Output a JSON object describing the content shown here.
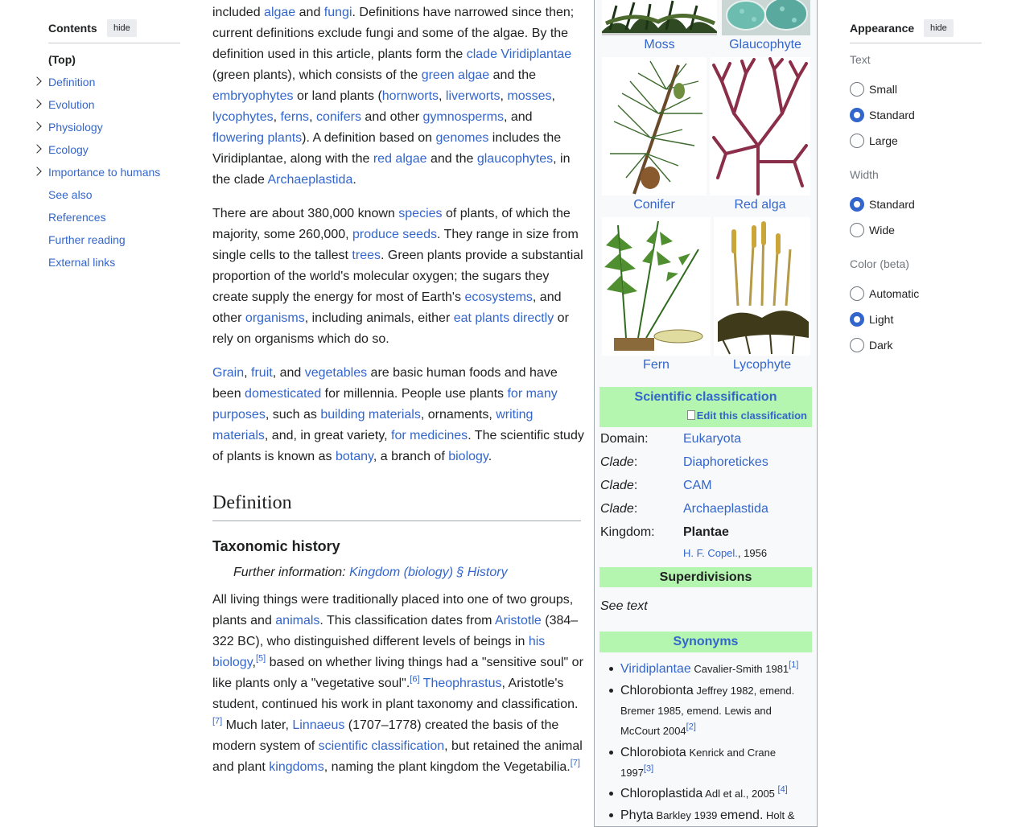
{
  "toc": {
    "title": "Contents",
    "hide_label": "hide",
    "items": [
      {
        "label": "(Top)",
        "expandable": false
      },
      {
        "label": "Definition",
        "expandable": true
      },
      {
        "label": "Evolution",
        "expandable": true
      },
      {
        "label": "Physiology",
        "expandable": true
      },
      {
        "label": "Ecology",
        "expandable": true
      },
      {
        "label": "Importance to humans",
        "expandable": true
      },
      {
        "label": "See also",
        "expandable": false
      },
      {
        "label": "References",
        "expandable": false
      },
      {
        "label": "Further reading",
        "expandable": false
      },
      {
        "label": "External links",
        "expandable": false
      }
    ]
  },
  "article": {
    "p1": [
      {
        "t": "included "
      },
      {
        "l": "algae"
      },
      {
        "t": " and "
      },
      {
        "l": "fungi"
      },
      {
        "t": ". Definitions have narrowed since then; current definitions exclude fungi and some of the algae. By the definition used in this article, plants form the "
      },
      {
        "l": "clade"
      },
      {
        "t": " "
      },
      {
        "l": "Viridiplantae"
      },
      {
        "t": " (green plants), which consists of the "
      },
      {
        "l": "green algae"
      },
      {
        "t": " and the "
      },
      {
        "l": "embryophytes"
      },
      {
        "t": " or land plants ("
      },
      {
        "l": "hornworts"
      },
      {
        "t": ", "
      },
      {
        "l": "liverworts"
      },
      {
        "t": ", "
      },
      {
        "l": "mosses"
      },
      {
        "t": ", "
      },
      {
        "l": "lycophytes"
      },
      {
        "t": ", "
      },
      {
        "l": "ferns"
      },
      {
        "t": ", "
      },
      {
        "l": "conifers"
      },
      {
        "t": " and other "
      },
      {
        "l": "gymnosperms"
      },
      {
        "t": ", and "
      },
      {
        "l": "flowering plants"
      },
      {
        "t": "). A definition based on "
      },
      {
        "l": "genomes"
      },
      {
        "t": " includes the Viridiplantae, along with the "
      },
      {
        "l": "red algae"
      },
      {
        "t": " and the "
      },
      {
        "l": "glaucophytes"
      },
      {
        "t": ", in the clade "
      },
      {
        "l": "Archaeplastida"
      },
      {
        "t": "."
      }
    ],
    "p2": [
      {
        "t": "There are about 380,000 known "
      },
      {
        "l": "species"
      },
      {
        "t": " of plants, of which the majority, some 260,000, "
      },
      {
        "l": "produce seeds"
      },
      {
        "t": ". They range in size from single cells to the tallest "
      },
      {
        "l": "trees"
      },
      {
        "t": ". Green plants provide a substantial proportion of the world's molecular oxygen; the sugars they create supply the energy for most of Earth's "
      },
      {
        "l": "ecosystems"
      },
      {
        "t": ", and other "
      },
      {
        "l": "organisms"
      },
      {
        "t": ", including animals, either "
      },
      {
        "l": "eat plants directly"
      },
      {
        "t": " or rely on organisms which do so."
      }
    ],
    "p3": [
      {
        "l": "Grain"
      },
      {
        "t": ", "
      },
      {
        "l": "fruit"
      },
      {
        "t": ", and "
      },
      {
        "l": "vegetables"
      },
      {
        "t": " are basic human foods and have been "
      },
      {
        "l": "domesticated"
      },
      {
        "t": " for millennia. People use plants "
      },
      {
        "l": "for many purposes"
      },
      {
        "t": ", such as "
      },
      {
        "l": "building materials"
      },
      {
        "t": ", ornaments, "
      },
      {
        "l": "writing materials"
      },
      {
        "t": ", and, in great variety, "
      },
      {
        "l": "for medicines"
      },
      {
        "t": ". The scientific study of plants is known as "
      },
      {
        "l": "botany"
      },
      {
        "t": ", a branch of "
      },
      {
        "l": "biology"
      },
      {
        "t": "."
      }
    ],
    "h2": "Definition",
    "h3": "Taxonomic history",
    "hatnote_prefix": "Further information: ",
    "hatnote_link": "Kingdom (biology) § History",
    "p4": [
      {
        "t": "All living things were traditionally placed into one of two groups, plants and "
      },
      {
        "l": "animals"
      },
      {
        "t": ". This classification dates from "
      },
      {
        "l": "Aristotle"
      },
      {
        "t": " (384–322 BC), who distinguished different levels of beings in "
      },
      {
        "l": "his biology"
      },
      {
        "t": ","
      },
      {
        "s": "[5]"
      },
      {
        "t": " based on whether living things had a \"sensitive soul\" or like plants only a \"vegetative soul\"."
      },
      {
        "s": "[6]"
      },
      {
        "t": " "
      },
      {
        "l": "Theophrastus"
      },
      {
        "t": ", Aristotle's student, continued his work in plant taxonomy and classification."
      },
      {
        "s": "[7]"
      },
      {
        "t": " Much later, "
      },
      {
        "l": "Linnaeus"
      },
      {
        "t": " (1707–1778) created the basis of the modern system of "
      },
      {
        "l": "scientific classification"
      },
      {
        "t": ", but retained the animal and plant "
      },
      {
        "l": "kingdoms"
      },
      {
        "t": ", naming the plant kingdom the Vegetabilia."
      },
      {
        "s": "[7]"
      }
    ]
  },
  "infobox": {
    "captions": [
      "Moss",
      "Glaucophyte",
      "Conifer",
      "Red alga",
      "Fern",
      "Lycophyte"
    ],
    "sci_class": "Scientific classification",
    "edit_class": "Edit this classification",
    "taxonomy": [
      {
        "rank": "Domain:",
        "italic": false,
        "value": "Eukaryota",
        "bold": false
      },
      {
        "rank": "Clade",
        "italic": true,
        "value": "Diaphoretickes",
        "bold": false
      },
      {
        "rank": "Clade",
        "italic": true,
        "value": "CAM",
        "bold": false
      },
      {
        "rank": "Clade",
        "italic": true,
        "value": "Archaeplastida",
        "bold": false
      },
      {
        "rank": "Kingdom:",
        "italic": false,
        "value": "Plantae",
        "bold": true
      }
    ],
    "authority_link": "H. F. Copel.",
    "authority_year": ", 1956",
    "superdivisions": "Superdivisions",
    "see_text": "See text",
    "synonyms_title": "Synonyms",
    "synonyms": [
      [
        {
          "l": "Viridiplantae"
        },
        {
          "sm": " Cavalier-Smith 1981"
        },
        {
          "s": "[1]"
        }
      ],
      [
        {
          "t": "Chlorobionta"
        },
        {
          "sm": " Jeffrey 1982, emend. Bremer 1985, emend. Lewis and McCourt 2004"
        },
        {
          "s": "[2]"
        }
      ],
      [
        {
          "t": "Chlorobiota"
        },
        {
          "sm": " Kenrick and Crane 1997"
        },
        {
          "s": "[3]"
        }
      ],
      [
        {
          "t": "Chloroplastida"
        },
        {
          "sm": " Adl et al., 2005 "
        },
        {
          "s": "[4]"
        }
      ],
      [
        {
          "t": "Phyta"
        },
        {
          "sm": " Barkley 1939 "
        },
        {
          "t": "emend."
        },
        {
          "sm": " Holt &"
        }
      ]
    ]
  },
  "appearance": {
    "title": "Appearance",
    "hide_label": "hide",
    "text_label": "Text",
    "text_options": [
      {
        "label": "Small",
        "checked": false
      },
      {
        "label": "Standard",
        "checked": true
      },
      {
        "label": "Large",
        "checked": false
      }
    ],
    "width_label": "Width",
    "width_options": [
      {
        "label": "Standard",
        "checked": true
      },
      {
        "label": "Wide",
        "checked": false
      }
    ],
    "color_label": "Color (beta)",
    "color_options": [
      {
        "label": "Automatic",
        "checked": false
      },
      {
        "label": "Light",
        "checked": true
      },
      {
        "label": "Dark",
        "checked": false
      }
    ]
  }
}
